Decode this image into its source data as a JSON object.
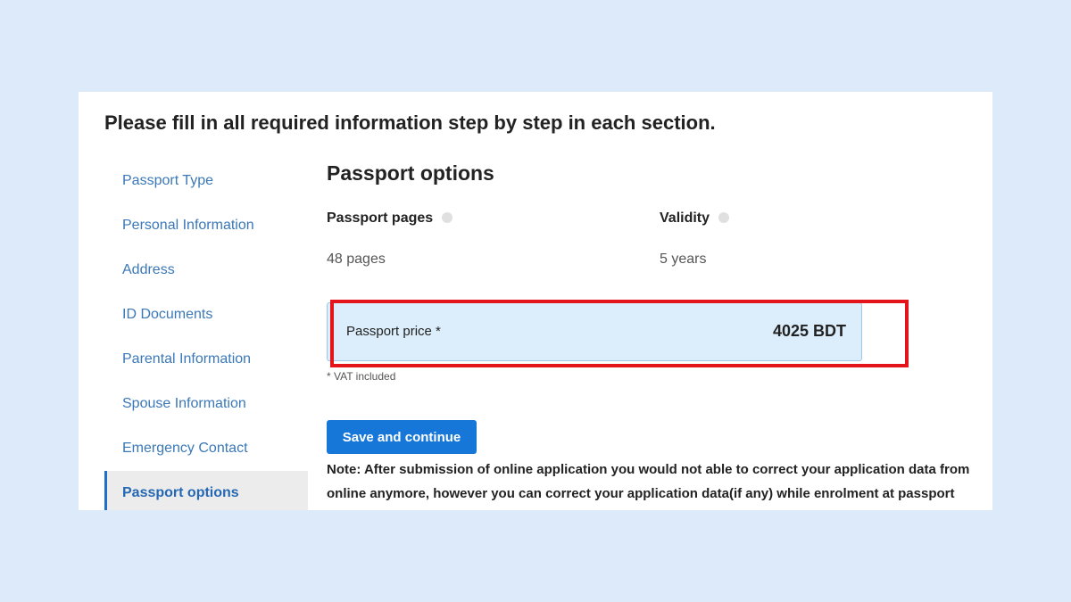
{
  "instruction": "Please fill in all required information step by step in each section.",
  "sidebar": {
    "items": [
      {
        "label": "Passport Type"
      },
      {
        "label": "Personal Information"
      },
      {
        "label": "Address"
      },
      {
        "label": "ID Documents"
      },
      {
        "label": "Parental Information"
      },
      {
        "label": "Spouse Information"
      },
      {
        "label": "Emergency Contact"
      },
      {
        "label": "Passport options",
        "active": true
      }
    ]
  },
  "main": {
    "title": "Passport options",
    "pages": {
      "label": "Passport pages",
      "value": "48 pages",
      "icon": "help-icon"
    },
    "validity": {
      "label": "Validity",
      "value": "5 years",
      "icon": "help-icon"
    },
    "price": {
      "label": "Passport price *",
      "value": "4025 BDT"
    },
    "vat_note": "* VAT included",
    "save_label": "Save and continue",
    "note": "Note: After submission of online application you would not able to correct your application data from online anymore, however you can correct your application data(if any) while enrolment at passport office. Please inform your correct data (with a written letter) to the passport office and"
  },
  "colors": {
    "highlight": "#e4141b",
    "accent": "#1677d9",
    "background": "#dceaf9"
  }
}
